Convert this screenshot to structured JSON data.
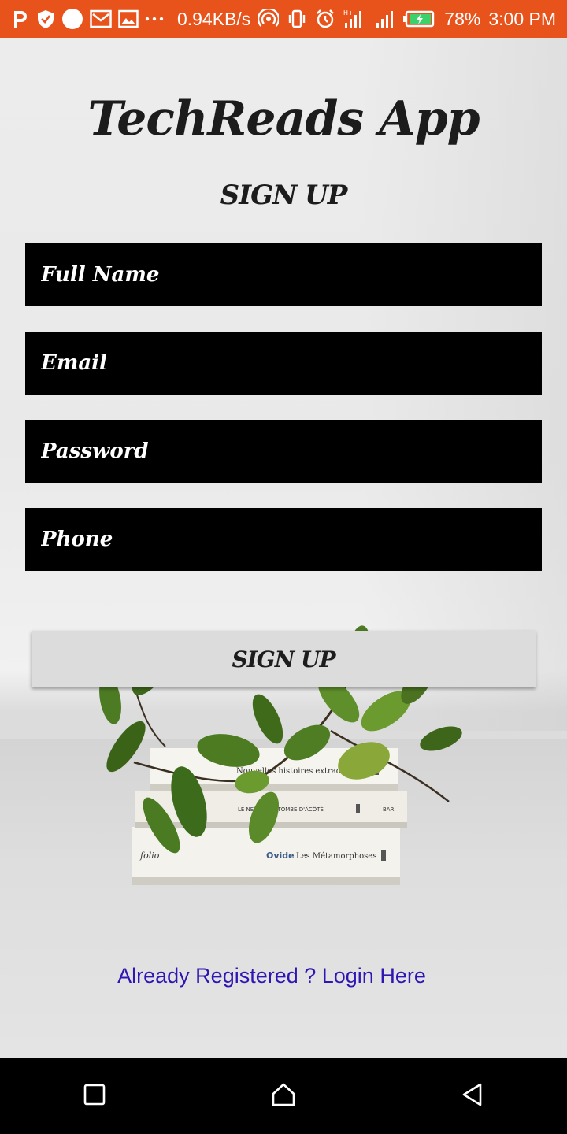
{
  "status_bar": {
    "speed": "0.94KB/s",
    "battery": "78%",
    "time": "3:00 PM",
    "background_color": "#e8531c",
    "left_icons": [
      "p-icon",
      "shield-icon",
      "circle-icon",
      "mail-icon",
      "image-icon",
      "more-icon"
    ],
    "right_icons": [
      "hotspot-icon",
      "vibrate-icon",
      "alarm-icon",
      "signal-icon",
      "signal-icon",
      "battery-icon"
    ]
  },
  "app": {
    "title": "TechReads App",
    "subtitle": "SIGN UP"
  },
  "form": {
    "full_name_placeholder": "Full Name",
    "email_placeholder": "Email",
    "password_placeholder": "Password",
    "phone_placeholder": "Phone",
    "submit_label": "SIGN UP"
  },
  "books": {
    "top": "Nouvelles histoires extraordinaires",
    "middle": "LE NEC DE LA TOMBE D'ÂCÔTÉ",
    "bottom_brand": "folio",
    "bottom_author": "Ovide",
    "bottom_title": "Les Métamorphoses"
  },
  "login_link": "Already Registered ? Login Here",
  "nav_bar": {
    "icons": [
      "recent-apps-icon",
      "home-icon",
      "back-icon"
    ]
  }
}
